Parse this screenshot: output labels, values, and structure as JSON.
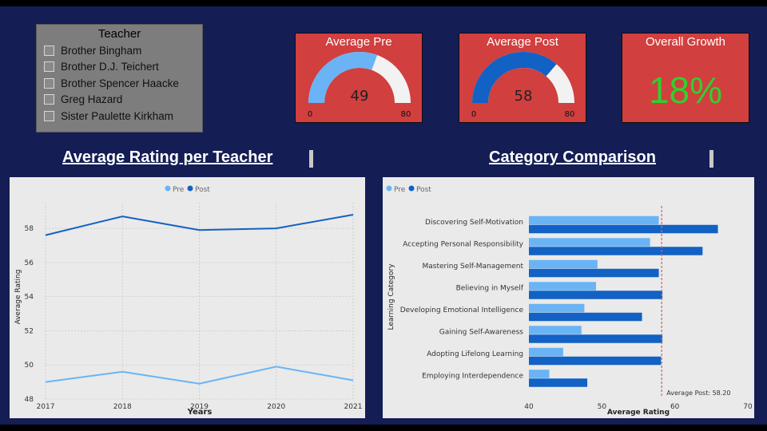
{
  "slicer": {
    "title": "Teacher",
    "items": [
      {
        "label": "Brother Bingham"
      },
      {
        "label": "Brother D.J. Teichert"
      },
      {
        "label": "Brother Spencer Haacke"
      },
      {
        "label": "Greg Hazard"
      },
      {
        "label": "Sister Paulette Kirkham"
      }
    ]
  },
  "cards": {
    "avg_pre": {
      "title": "Average Pre",
      "value": "49",
      "min": "0",
      "max": "80",
      "fraction": 0.6125,
      "fill_color": "#6ab4f5"
    },
    "avg_post": {
      "title": "Average Post",
      "value": "58",
      "min": "0",
      "max": "80",
      "fraction": 0.725,
      "fill_color": "#1261c4"
    },
    "growth": {
      "title": "Overall Growth",
      "value": "18%"
    }
  },
  "titles": {
    "line": "Average Rating per Teacher",
    "bar": "Category Comparison"
  },
  "colors": {
    "pre": "#6ab4f5",
    "post": "#1261c4",
    "card": "#d13f3f",
    "growth": "#2fd02f"
  },
  "chart_data": [
    {
      "type": "line",
      "x": [
        2017,
        2018,
        2019,
        2020,
        2021
      ],
      "series": [
        {
          "name": "Pre",
          "values": [
            49.0,
            49.6,
            48.9,
            49.9,
            49.1
          ]
        },
        {
          "name": "Post",
          "values": [
            57.6,
            58.7,
            57.9,
            58.0,
            58.8
          ]
        }
      ],
      "xlabel": "Years",
      "ylabel": "Average Rating",
      "yticks": [
        48,
        50,
        52,
        54,
        56,
        58
      ],
      "ylim": [
        48,
        59.5
      ],
      "legend": "top-center",
      "grid": true
    },
    {
      "type": "bar",
      "orientation": "horizontal",
      "categories": [
        "Discovering Self-Motivation",
        "Accepting Personal Responsibility",
        "Mastering Self-Management",
        "Believing in Myself",
        "Developing Emotional Intelligence",
        "Gaining Self-Awareness",
        "Adopting Lifelong Learning",
        "Employing Interdependence"
      ],
      "series": [
        {
          "name": "Pre",
          "values": [
            57.8,
            56.6,
            49.4,
            49.2,
            47.6,
            47.2,
            44.7,
            42.8
          ]
        },
        {
          "name": "Post",
          "values": [
            65.9,
            63.8,
            57.8,
            58.3,
            55.5,
            58.3,
            58.1,
            48.0
          ]
        }
      ],
      "xlabel": "Average Rating",
      "ylabel": "Learning Category",
      "xticks": [
        40,
        50,
        60,
        70
      ],
      "xlim": [
        40,
        70
      ],
      "reference_line": {
        "value": 58.2,
        "label": "Average Post: 58.20"
      },
      "legend": "top-left"
    }
  ]
}
